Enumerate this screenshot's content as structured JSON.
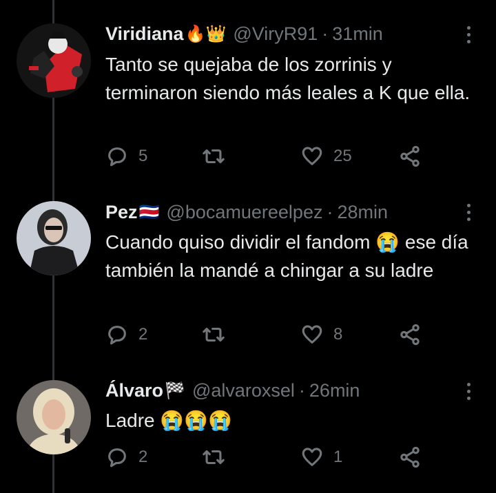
{
  "tweets": [
    {
      "name": "Viridiana",
      "name_emoji": "🔥👑",
      "handle": "@ViryR91",
      "separator": "·",
      "time": "31min",
      "text": "Tanto se quejaba de los zorrinis y terminaron siendo más leales a K que ella.",
      "replies": "5",
      "retweets": "",
      "likes": "25"
    },
    {
      "name": "Pez",
      "name_emoji": "🇨🇷",
      "handle": "@bocamuereelpez",
      "separator": "·",
      "time": "28min",
      "text": "Cuando quiso dividir el fandom 😭 ese día también la mandé a chingar a su ladre",
      "replies": "2",
      "retweets": "",
      "likes": "8"
    },
    {
      "name": "Álvaro",
      "name_emoji": "🏁",
      "handle": "@alvaroxsel",
      "separator": "·",
      "time": "26min",
      "text": "Ladre 😭😭😭",
      "replies": "2",
      "retweets": "",
      "likes": "1"
    }
  ],
  "icons": {
    "reply": "reply-icon",
    "retweet": "retweet-icon",
    "like": "heart-icon",
    "share": "share-icon",
    "more": "more-icon"
  },
  "colors": {
    "background": "#000000",
    "text": "#e7e9ea",
    "muted": "#71767b",
    "thread_line": "#2f3336"
  }
}
